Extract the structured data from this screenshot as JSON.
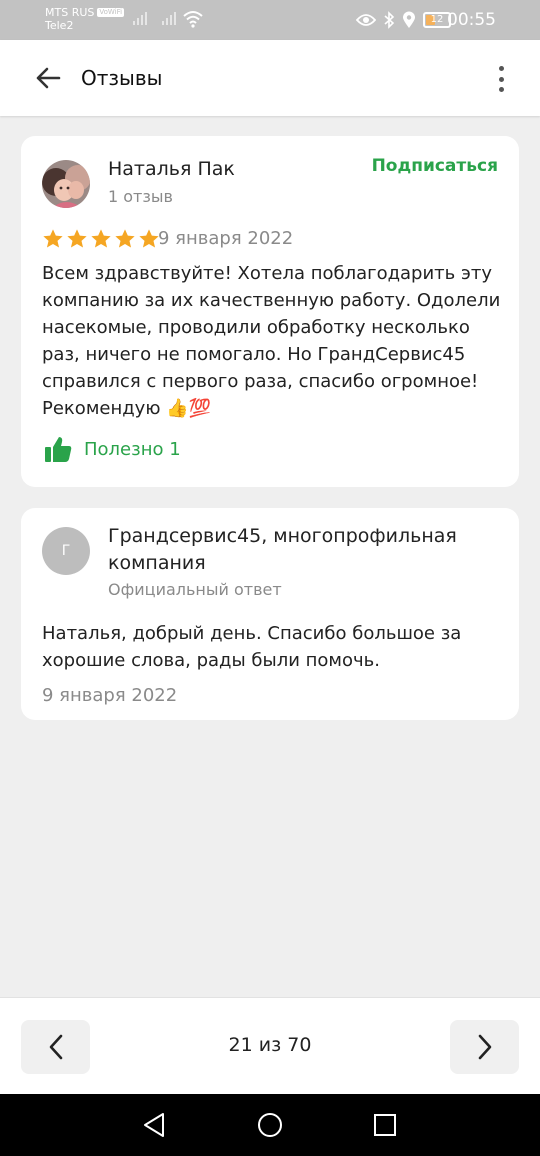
{
  "status_bar": {
    "carrier1": "MTS RUS",
    "volte": "VoWiFi",
    "carrier2": "Tele2",
    "battery": "12",
    "time": "00:55"
  },
  "app_bar": {
    "title": "Отзывы",
    "back_icon": "arrow-left-icon",
    "menu_icon": "more-vertical-icon"
  },
  "review": {
    "author": "Наталья Пак",
    "author_meta": "1 отзыв",
    "subscribe_label": "Подписаться",
    "rating": 5,
    "rating_max": 5,
    "date": "9 января 2022",
    "text": "Всем здравствуйте! Хотела поблагодарить эту компанию за их качественную работу. Одолели насекомые, проводили обработку несколько раз, ничего не помогало. Но ГрандСервис45 справился с первого раза, спасибо огромное! Рекомендую 👍💯",
    "helpful_label": "Полезно 1",
    "star_color": "#f5a623",
    "accent_color": "#2aa34a"
  },
  "reply": {
    "avatar_letter": "Г",
    "company": "Грандсервис45, многопрофильная компания",
    "meta": "Официальный ответ",
    "text": "Наталья, добрый день. Спасибо большое за хорошие слова, рады были помочь.",
    "date": "9 января 2022"
  },
  "pager": {
    "label": "21 из 70",
    "prev_icon": "chevron-left-icon",
    "next_icon": "chevron-right-icon"
  },
  "system_nav": {
    "back_icon": "triangle-back-icon",
    "home_icon": "circle-home-icon",
    "recents_icon": "square-recents-icon"
  }
}
